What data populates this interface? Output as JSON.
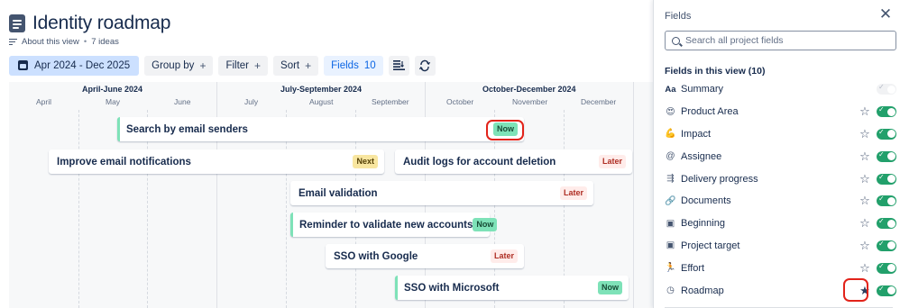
{
  "page": {
    "title": "Identity roadmap",
    "about_label": "About this view",
    "separator": "•",
    "ideas_count": "7 ideas"
  },
  "toolbar": {
    "date_range": "Apr 2024 - Dec 2025",
    "group_by": "Group by",
    "filter": "Filter",
    "sort": "Sort",
    "fields_label": "Fields",
    "fields_count": "10",
    "plus": "+"
  },
  "timeline": {
    "quarters": [
      "April-June 2024",
      "July-September 2024",
      "October-December 2024"
    ],
    "months": [
      "April",
      "May",
      "June",
      "July",
      "August",
      "September",
      "October",
      "November",
      "December"
    ],
    "ideas": [
      {
        "title": "Search by email senders",
        "status": "Now"
      },
      {
        "title": "Improve email notifications",
        "status": "Next"
      },
      {
        "title": "Audit logs for account deletion",
        "status": "Later"
      },
      {
        "title": "Email validation",
        "status": "Later"
      },
      {
        "title": "Reminder to validate new accounts",
        "status": "Now"
      },
      {
        "title": "SSO with Google",
        "status": "Later"
      },
      {
        "title": "SSO with Microsoft",
        "status": "Now"
      }
    ]
  },
  "panel": {
    "title": "Fields",
    "search_placeholder": "Search all project fields",
    "section_heading": "Fields in this view (10)",
    "fields": [
      {
        "icon": "Aa",
        "icon_name": "text-icon",
        "label": "Summary",
        "starred": false,
        "has_star": false,
        "enabled": true,
        "locked": true
      },
      {
        "icon": "😍",
        "icon_name": "emoji-icon",
        "label": "Product Area",
        "starred": false,
        "has_star": true,
        "enabled": true
      },
      {
        "icon": "💪",
        "icon_name": "muscle-emoji-icon",
        "label": "Impact",
        "starred": false,
        "has_star": true,
        "enabled": true
      },
      {
        "icon": "@",
        "icon_name": "mention-icon",
        "label": "Assignee",
        "starred": false,
        "has_star": true,
        "enabled": true
      },
      {
        "icon": "⇶",
        "icon_name": "progress-icon",
        "label": "Delivery progress",
        "starred": false,
        "has_star": true,
        "enabled": true
      },
      {
        "icon": "🔗",
        "icon_name": "link-icon",
        "label": "Documents",
        "starred": false,
        "has_star": true,
        "enabled": true
      },
      {
        "icon": "▣",
        "icon_name": "calendar-icon",
        "label": "Beginning",
        "starred": false,
        "has_star": true,
        "enabled": true
      },
      {
        "icon": "▣",
        "icon_name": "calendar-icon",
        "label": "Project target",
        "starred": false,
        "has_star": true,
        "enabled": true
      },
      {
        "icon": "🏃",
        "icon_name": "runner-emoji-icon",
        "label": "Effort",
        "starred": false,
        "has_star": true,
        "enabled": true
      },
      {
        "icon": "◷",
        "icon_name": "clock-icon",
        "label": "Roadmap",
        "starred": true,
        "has_star": true,
        "enabled": true
      }
    ]
  },
  "colors": {
    "now": "#7ee2b8",
    "next": "#f8e6a0",
    "later": "#ffecea",
    "toggle_on": "#22a06b",
    "highlight_ring": "#e2231a",
    "date_button": "#cce0ff"
  }
}
